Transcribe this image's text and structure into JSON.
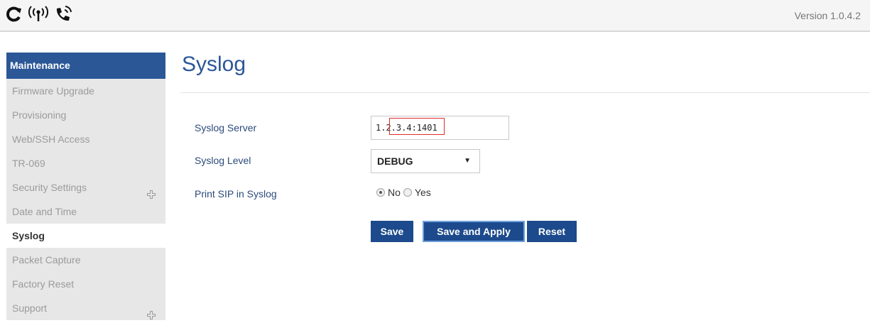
{
  "header": {
    "icons": [
      "refresh-icon",
      "antenna-icon",
      "phone-ringing-icon"
    ],
    "version": "Version 1.0.4.2"
  },
  "sidebar": {
    "title": "Maintenance",
    "items": [
      {
        "label": "Firmware Upgrade",
        "expandable": false,
        "active": false
      },
      {
        "label": "Provisioning",
        "expandable": false,
        "active": false
      },
      {
        "label": "Web/SSH Access",
        "expandable": false,
        "active": false
      },
      {
        "label": "TR-069",
        "expandable": false,
        "active": false
      },
      {
        "label": "Security Settings",
        "expandable": true,
        "active": false
      },
      {
        "label": "Date and Time",
        "expandable": false,
        "active": false
      },
      {
        "label": "Syslog",
        "expandable": false,
        "active": true
      },
      {
        "label": "Packet Capture",
        "expandable": false,
        "active": false
      },
      {
        "label": "Factory Reset",
        "expandable": false,
        "active": false
      },
      {
        "label": "Support",
        "expandable": true,
        "active": false
      }
    ]
  },
  "main": {
    "title": "Syslog",
    "fields": {
      "server_label": "Syslog Server",
      "server_value": "1.2.3.4:1401",
      "level_label": "Syslog Level",
      "level_value": "DEBUG",
      "sip_label": "Print SIP in Syslog",
      "sip_options": [
        "No",
        "Yes"
      ],
      "sip_selected": "No"
    },
    "buttons": {
      "save": "Save",
      "save_apply": "Save and Apply",
      "reset": "Reset"
    }
  },
  "colors": {
    "brand": "#2b5797",
    "button": "#1c4a8c",
    "highlight": "#e22b2b"
  }
}
